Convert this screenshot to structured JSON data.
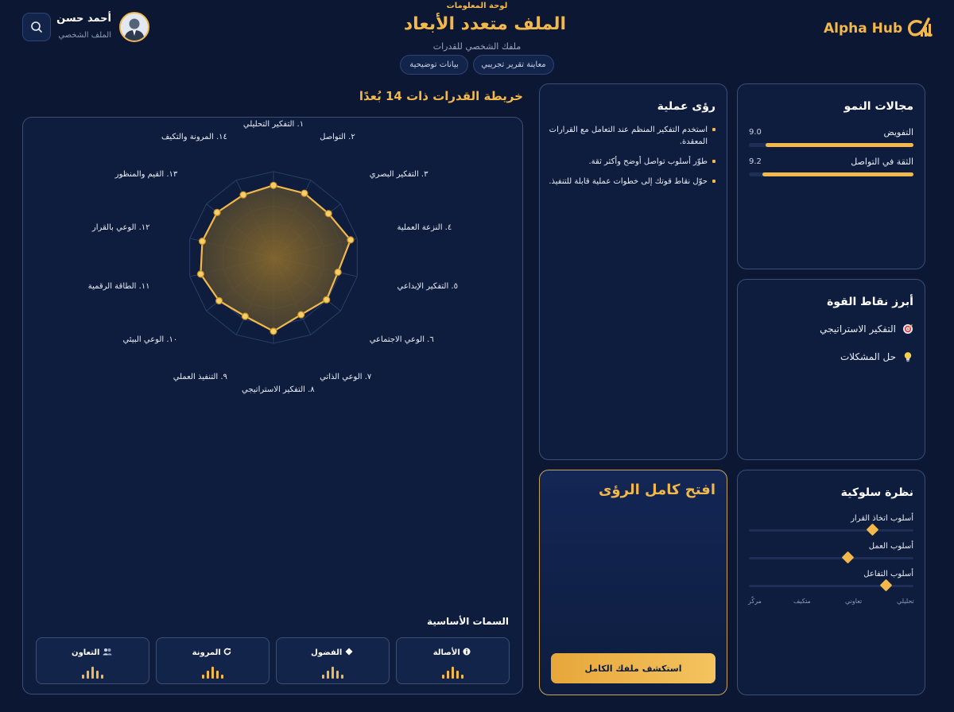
{
  "header": {
    "breadcrumb": "لوحة المعلومات",
    "title": "الملف متعدد الأبعاد",
    "subtitle": "ملفك الشخصي للقدرات",
    "pills": [
      "معاينة تقرير تجريبي",
      "بيانات توضيحية"
    ],
    "brand": "Alpha Hub",
    "user_name": "أحمد حسن",
    "user_role": "الملف الشخصي"
  },
  "radar": {
    "section_title": "خريطة القدرات ذات 14 بُعدًا",
    "dimensions": [
      "١. التفكير التحليلي",
      "٢. التواصل",
      "٣. التفكير البصري",
      "٤. النزعة العملية",
      "٥. التفكير الإبداعي",
      "٦. الوعي الاجتماعي",
      "٧. الوعي الذاتي",
      "٨. التفكير الاستراتيجي",
      "٩. التنفيذ العملي",
      "١٠. الوعي البيئي",
      "١١. الطاقة الرقمية",
      "١٢. الوعي بالقرار",
      "١٣. القيم والمنظور",
      "١٤. المرونة والتكيف"
    ],
    "values": [
      0.84,
      0.83,
      0.82,
      0.92,
      0.77,
      0.79,
      0.74,
      0.86,
      0.76,
      0.81,
      0.87,
      0.85,
      0.84,
      0.81
    ]
  },
  "traits": {
    "title": "السمات الأساسية",
    "items": [
      {
        "icon": "info-icon",
        "label": "الأصالة"
      },
      {
        "icon": "diamond-icon",
        "label": "الفضول"
      },
      {
        "icon": "refresh-icon",
        "label": "المرونة"
      },
      {
        "icon": "people-icon",
        "label": "التعاون"
      }
    ]
  },
  "insights": {
    "title": "رؤى عملية",
    "items": [
      "استخدم التفكير المنظم عند التعامل مع القرارات المعقدة.",
      "طوّر أسلوب تواصل أوضح وأكثر ثقة.",
      "حوّل نقاط قوتك إلى خطوات عملية قابلة للتنفيذ."
    ]
  },
  "growth": {
    "title": "مجالات النمو",
    "items": [
      {
        "label": "التفويض",
        "value": "9.0",
        "fraction": 0.9
      },
      {
        "label": "الثقة في التواصل",
        "value": "9.2",
        "fraction": 0.92
      }
    ]
  },
  "strengths": {
    "title": "أبرز نقاط القوة",
    "items": [
      {
        "icon": "target-icon",
        "label": "التفكير الاستراتيجي"
      },
      {
        "icon": "lightbulb-icon",
        "label": "حل المشكلات"
      }
    ]
  },
  "behavior": {
    "title": "نظرة سلوكية",
    "sliders": [
      {
        "label": "أسلوب اتخاذ القرار",
        "level": 0.75
      },
      {
        "label": "أسلوب العمل",
        "level": 0.6
      },
      {
        "label": "أسلوب التفاعل",
        "level": 0.83
      }
    ],
    "axis": [
      "تحليلي",
      "تعاوني",
      "متكيف",
      "مركّز"
    ]
  },
  "unlock": {
    "title": "افتح كامل الرؤى",
    "button": "استكشف ملفك الكامل"
  },
  "colors": {
    "accent": "#f2b84b",
    "background": "#0b1733",
    "card": "#0e1d3e"
  }
}
